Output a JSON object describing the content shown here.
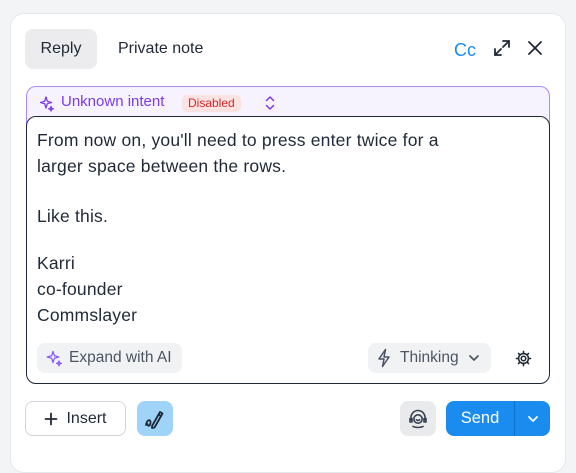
{
  "tabs": {
    "reply": "Reply",
    "private_note": "Private note"
  },
  "header": {
    "cc_label": "Cc"
  },
  "intent": {
    "label": "Unknown intent",
    "badge": "Disabled"
  },
  "editor": {
    "lines": [
      "From now on, you'll need to press enter twice for a",
      "larger space between the rows.",
      "Like this.",
      "Karri",
      "co-founder",
      "Commslayer"
    ]
  },
  "toolbar": {
    "expand_ai_label": "Expand with AI",
    "thinking_label": "Thinking"
  },
  "footer": {
    "insert_label": "Insert",
    "send_label": "Send"
  },
  "colors": {
    "accent": "#1a8cf0",
    "intent_purple": "#7c3aed",
    "badge_red": "#dc2626",
    "signature_bg": "#9fd3f7"
  },
  "icons": {
    "expand": "expand-arrows-icon",
    "close": "close-icon",
    "intent": "sparkle-icon",
    "intent_select": "chevron-up-down-icon",
    "ai": "sparkle-icon",
    "thinking": "lightning-icon",
    "thinking_dropdown": "chevron-down-icon",
    "settings": "gear-icon",
    "insert": "plus-icon",
    "signature": "signature-pen-icon",
    "agent": "agent-face-icon",
    "send_menu": "chevron-down-icon"
  }
}
